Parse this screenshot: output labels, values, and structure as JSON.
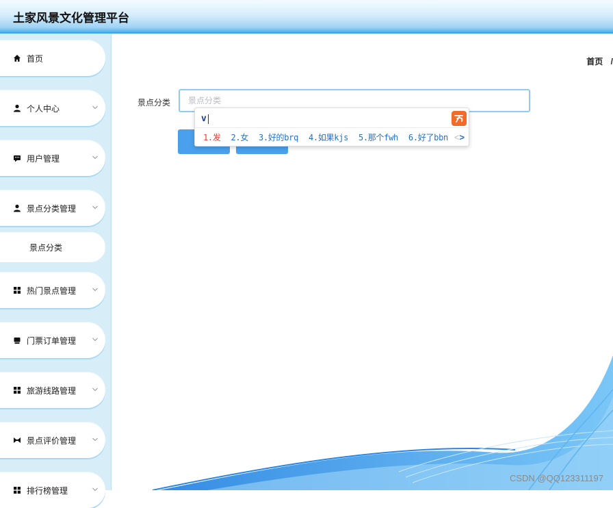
{
  "app": {
    "title": "土家风景文化管理平台"
  },
  "sidebar": {
    "items": [
      {
        "label": "首页",
        "icon": "home-icon",
        "has_chevron": false
      },
      {
        "label": "个人中心",
        "icon": "user-icon",
        "has_chevron": true
      },
      {
        "label": "用户管理",
        "icon": "chat-icon",
        "has_chevron": true
      },
      {
        "label": "景点分类管理",
        "icon": "user-icon",
        "has_chevron": true
      },
      {
        "label": "热门景点管理",
        "icon": "grid-icon",
        "has_chevron": true
      },
      {
        "label": "门票订单管理",
        "icon": "ticket-icon",
        "has_chevron": true
      },
      {
        "label": "旅游线路管理",
        "icon": "grid-icon",
        "has_chevron": true
      },
      {
        "label": "景点评价管理",
        "icon": "rating-icon",
        "has_chevron": true
      },
      {
        "label": "排行榜管理",
        "icon": "grid-icon",
        "has_chevron": true
      }
    ],
    "sub_item": {
      "label": "景点分类"
    }
  },
  "breadcrumb": {
    "home": "首页",
    "separator": "/"
  },
  "form": {
    "label": "景点分类",
    "input_value": "",
    "placeholder": "景点分类"
  },
  "ime": {
    "composition": "v",
    "candidates": [
      "1.发",
      "2.女",
      "3.好的brq",
      "4.如果kjs",
      "5.那个fwh",
      "6.好了bbn"
    ],
    "prev_arrow": "<",
    "next_arrow": ">",
    "logo_glyph": "S"
  },
  "watermark": "CSDN @QQ123311197",
  "colors": {
    "accent": "#4aa0ec",
    "header_bottom": "#3aa7ea",
    "sidebar_bg": "#d7edf8",
    "ime_logo": "#f26b2a",
    "first_candidate": "#e53f2f",
    "candidate": "#2671c8"
  }
}
